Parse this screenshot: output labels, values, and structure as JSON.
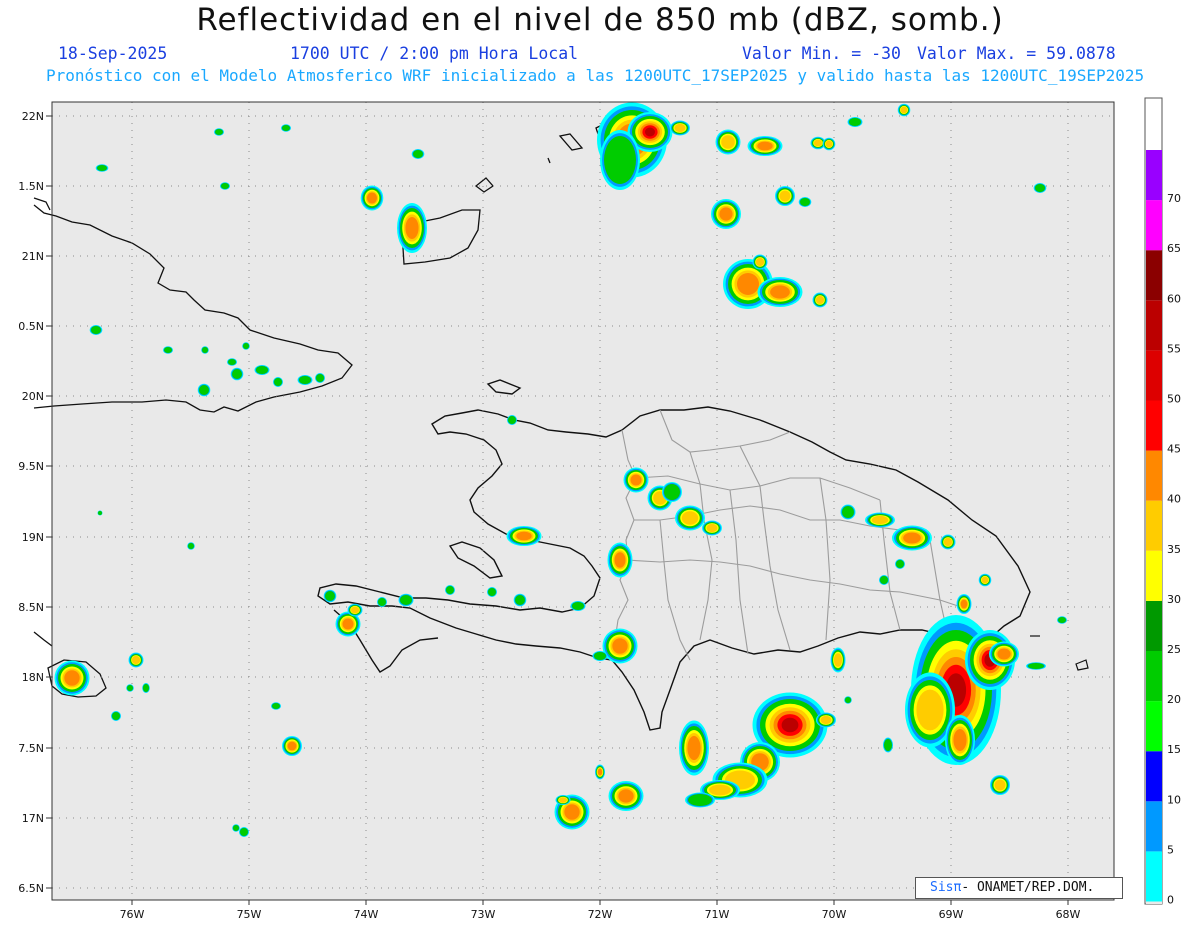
{
  "header": {
    "title": "Reflectividad en el nivel de 850 mb (dBZ, somb.)",
    "date": "18-Sep-2025",
    "time": "1700 UTC / 2:00 pm Hora Local",
    "min_label": "Valor Min. = -30",
    "max_label": "Valor Max. = 59.0878",
    "forecast_line": "Pronóstico con el Modelo Atmosferico WRF inicializado a las 1200UTC_17SEP2025 y valido hasta las  1200UTC_19SEP2025"
  },
  "map": {
    "lon_labels": [
      "76W",
      "75W",
      "74W",
      "73W",
      "72W",
      "71W",
      "70W",
      "69W",
      "68W"
    ],
    "lat_labels": [
      "22N",
      "1.5N",
      "21N",
      "0.5N",
      "20N",
      "9.5N",
      "19N",
      "8.5N",
      "18N",
      "7.5N",
      "17N",
      "6.5N"
    ],
    "background_color": "#e9e9e9",
    "coast_color": "#111111",
    "province_color": "#9a9a9a"
  },
  "colorbar": {
    "levels": [
      "0",
      "5",
      "10",
      "15",
      "20",
      "25",
      "30",
      "35",
      "40",
      "45",
      "50",
      "55",
      "60",
      "65",
      "70"
    ],
    "colors": [
      "#00ffff",
      "#0099ff",
      "#0000ff",
      "#00ff00",
      "#00cc00",
      "#009900",
      "#ffff00",
      "#ffcc00",
      "#ff8800",
      "#ff0000",
      "#dd0000",
      "#bb0000",
      "#8b0000",
      "#ff00ff",
      "#9900ff"
    ]
  },
  "credit": {
    "brand": "Sisπ",
    "text": "- ONAMET/REP.DOM."
  }
}
